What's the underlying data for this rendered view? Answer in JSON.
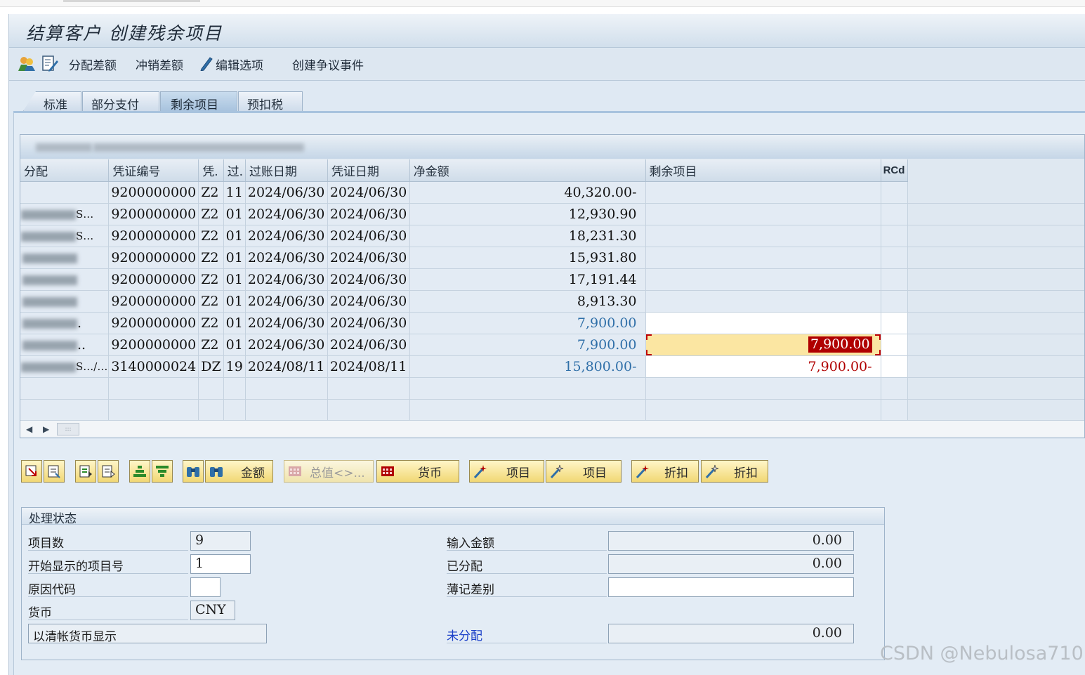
{
  "window": {
    "title": "结算客户 创建残余项目"
  },
  "toolbar": {
    "icon1": "people-overview-icon",
    "icon2": "edit-document-icon",
    "btn_distribute": "分配差额",
    "btn_writeoff": "冲销差额",
    "btn_edit_options": "编辑选项",
    "btn_dispute": "创建争议事件"
  },
  "tabs": [
    {
      "label": "标准",
      "active": false
    },
    {
      "label": "部分支付",
      "active": false
    },
    {
      "label": "剩余项目",
      "active": true
    },
    {
      "label": "预扣税",
      "active": false
    }
  ],
  "grid": {
    "columns": [
      "分配",
      "凭证编号",
      "凭.",
      "过.",
      "过账日期",
      "凭证日期",
      "净金额",
      "剩余项目",
      "RCd"
    ],
    "rows": [
      {
        "assign": "",
        "doc": "9200000000",
        "type": "Z2",
        "pk": "11",
        "post_date": "2024/06/30",
        "doc_date": "2024/06/30",
        "net": "40,320.00-",
        "residual": "",
        "rcd": ""
      },
      {
        "assign": "S…",
        "doc": "9200000000",
        "type": "Z2",
        "pk": "01",
        "post_date": "2024/06/30",
        "doc_date": "2024/06/30",
        "net": "12,930.90",
        "residual": "",
        "rcd": ""
      },
      {
        "assign": "S…",
        "doc": "9200000000",
        "type": "Z2",
        "pk": "01",
        "post_date": "2024/06/30",
        "doc_date": "2024/06/30",
        "net": "18,231.30",
        "residual": "",
        "rcd": ""
      },
      {
        "assign": "",
        "doc": "9200000000",
        "type": "Z2",
        "pk": "01",
        "post_date": "2024/06/30",
        "doc_date": "2024/06/30",
        "net": "15,931.80",
        "residual": "",
        "rcd": ""
      },
      {
        "assign": "",
        "doc": "9200000000",
        "type": "Z2",
        "pk": "01",
        "post_date": "2024/06/30",
        "doc_date": "2024/06/30",
        "net": "17,191.44",
        "residual": "",
        "rcd": ""
      },
      {
        "assign": "",
        "doc": "9200000000",
        "type": "Z2",
        "pk": "01",
        "post_date": "2024/06/30",
        "doc_date": "2024/06/30",
        "net": "8,913.30",
        "residual": "",
        "rcd": ""
      },
      {
        "assign": ".",
        "doc": "9200000000",
        "type": "Z2",
        "pk": "01",
        "post_date": "2024/06/30",
        "doc_date": "2024/06/30",
        "net": "7,900.00",
        "residual": "",
        "rcd": ""
      },
      {
        "assign": "..",
        "doc": "9200000000",
        "type": "Z2",
        "pk": "01",
        "post_date": "2024/06/30",
        "doc_date": "2024/06/30",
        "net": "7,900.00",
        "residual": "7,900.00",
        "rcd": ""
      },
      {
        "assign": "S…/…",
        "doc": "3140000024",
        "type": "DZ",
        "pk": "19",
        "post_date": "2024/08/11",
        "doc_date": "2024/08/11",
        "net": "15,800.00-",
        "residual": "7,900.00-",
        "rcd": ""
      }
    ]
  },
  "buttons": {
    "amount": "金额",
    "total": "总值<>...",
    "currency": "货币",
    "item1": "项目",
    "item2": "项目",
    "discount1": "折扣",
    "discount2": "折扣"
  },
  "status": {
    "title": "处理状态",
    "item_count_label": "项目数",
    "item_count": "9",
    "start_item_label": "开始显示的项目号",
    "start_item": "1",
    "reason_label": "原因代码",
    "reason": "",
    "currency_label": "货币",
    "currency": "CNY",
    "clearing_currency_btn": "以清帐货币显示",
    "entered_label": "输入金额",
    "entered": "0.00",
    "assigned_label": "已分配",
    "assigned": "0.00",
    "diff_label": "薄记差别",
    "diff": "",
    "unassigned_label": "未分配",
    "unassigned": "0.00"
  },
  "watermark": "CSDN @Nebulosa710",
  "colors": {
    "accent_blue": "#2f6fa8",
    "negative_red": "#b00000",
    "button_yellow": "#f1d874",
    "link_blue": "#1a3fc8"
  }
}
